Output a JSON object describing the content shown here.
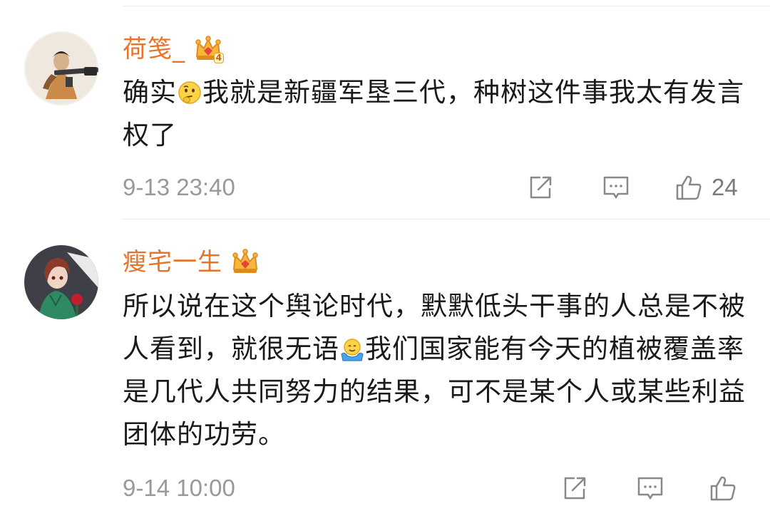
{
  "comments": [
    {
      "username": "荷笺_",
      "level_badge": "4",
      "text_before_emoji": "确实",
      "emoji_icon": "thinking-face-icon",
      "text_after_emoji": "我就是新疆军垦三代，种树这件事我太有发言权了",
      "time": "9-13 23:40",
      "likes": "24"
    },
    {
      "username": "瘦宅一生",
      "level_badge": "",
      "text_before_emoji": "所以说在这个舆论时代，默默低头干事的人总是不被人看到，就很无语",
      "emoji_icon": "shrug-face-icon",
      "text_after_emoji": "我们国家能有今天的植被覆盖率是几代人共同努力的结果，可不是某个人或某些利益团体的功劳。",
      "time": "9-14 10:00",
      "likes": ""
    }
  ],
  "colors": {
    "username": "#e8742a",
    "body_text": "#1a1a1a",
    "meta": "#999999",
    "divider": "#ececec"
  }
}
